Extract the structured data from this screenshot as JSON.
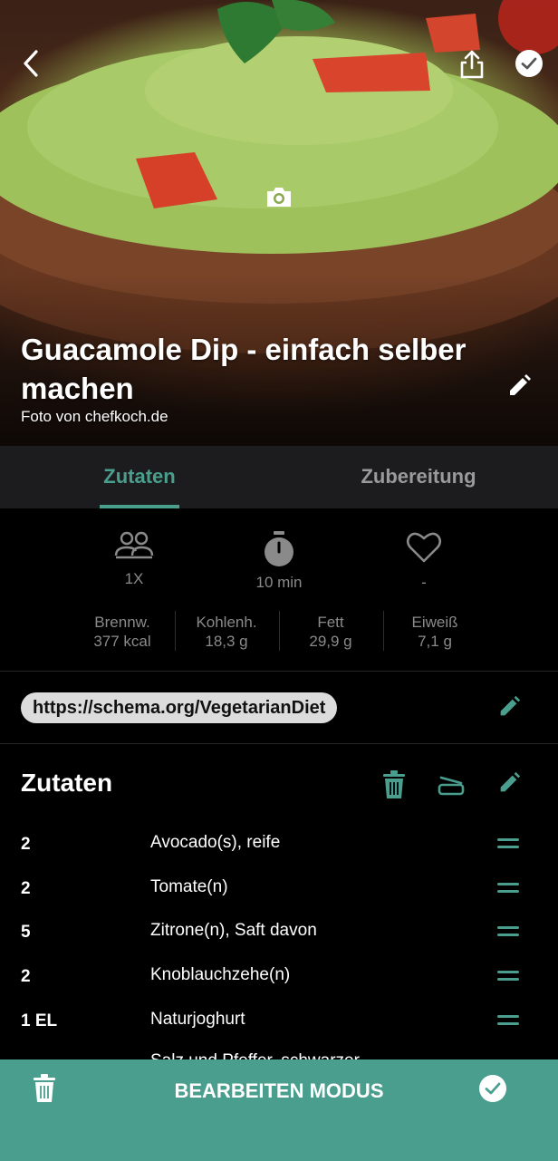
{
  "recipe": {
    "title": "Guacamole Dip - einfach selber machen",
    "photo_credit": "Foto von chefkoch.de"
  },
  "tabs": [
    {
      "label": "Zutaten",
      "active": true
    },
    {
      "label": "Zubereitung",
      "active": false
    }
  ],
  "meta": {
    "servings": "1X",
    "time": "10 min",
    "favorite": "-"
  },
  "nutrition": [
    {
      "label": "Brennw.",
      "value": "377 kcal"
    },
    {
      "label": "Kohlenh.",
      "value": "18,3 g"
    },
    {
      "label": "Fett",
      "value": "29,9 g"
    },
    {
      "label": "Eiweiß",
      "value": "7,1 g"
    }
  ],
  "tag": "https://schema.org/VegetarianDiet",
  "ingredients_section": {
    "title": "Zutaten",
    "items": [
      {
        "qty": "2",
        "name": "Avocado(s), reife"
      },
      {
        "qty": "2",
        "name": "Tomate(n)"
      },
      {
        "qty": "5",
        "name": "Zitrone(n), Saft davon"
      },
      {
        "qty": "2",
        "name": "Knoblauchzehe(n)"
      },
      {
        "qty": "1 EL",
        "name": "Naturjoghurt"
      },
      {
        "qty": "",
        "name": "Salz und Pfeffer, schwarzer"
      }
    ]
  },
  "bottom_bar": {
    "label": "BEARBEITEN MODUS"
  },
  "colors": {
    "accent": "#4a9e8e",
    "tab_bar": "#1c1c1e",
    "background": "#000000"
  }
}
